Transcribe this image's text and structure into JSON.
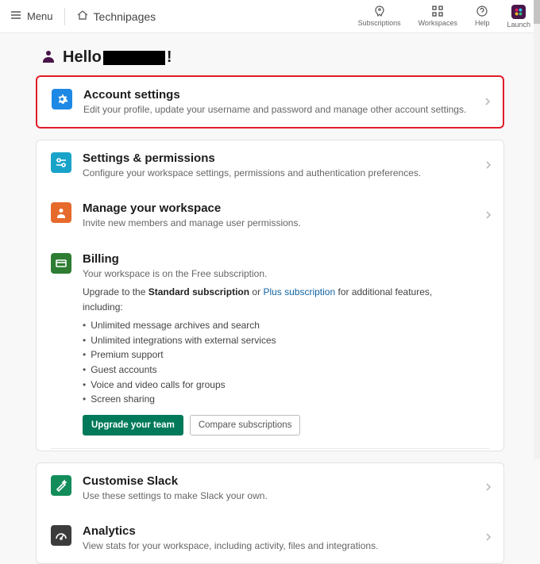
{
  "topbar": {
    "menu": "Menu",
    "brand": "Technipages",
    "subscriptions": "Subscriptions",
    "workspaces": "Workspaces",
    "help": "Help",
    "launch": "Launch"
  },
  "greeting": {
    "hello": "Hello",
    "exclaim": "!"
  },
  "account": {
    "title": "Account settings",
    "sub": "Edit your profile, update your username and password and manage other account settings."
  },
  "settingsPerms": {
    "title": "Settings & permissions",
    "sub": "Configure your workspace settings, permissions and authentication preferences."
  },
  "manage": {
    "title": "Manage your workspace",
    "sub": "Invite new members and manage user permissions."
  },
  "billing": {
    "title": "Billing",
    "sub_pre": "Your workspace is on the ",
    "sub_plan": "Free subscription",
    "sub_post": ".",
    "upgrade_pre": "Upgrade to the ",
    "std": "Standard subscription",
    "or": " or ",
    "plus": "Plus subscription",
    "upgrade_post": " for additional features, including:",
    "bullets": [
      "Unlimited message archives and search",
      "Unlimited integrations with external services",
      "Premium support",
      "Guest accounts",
      "Voice and video calls for groups",
      "Screen sharing"
    ],
    "btn_upgrade": "Upgrade your team",
    "btn_compare": "Compare subscriptions"
  },
  "customise": {
    "title": "Customise Slack",
    "sub": "Use these settings to make Slack your own."
  },
  "analytics": {
    "title": "Analytics",
    "sub": "View stats for your workspace, including activity, files and integrations."
  }
}
